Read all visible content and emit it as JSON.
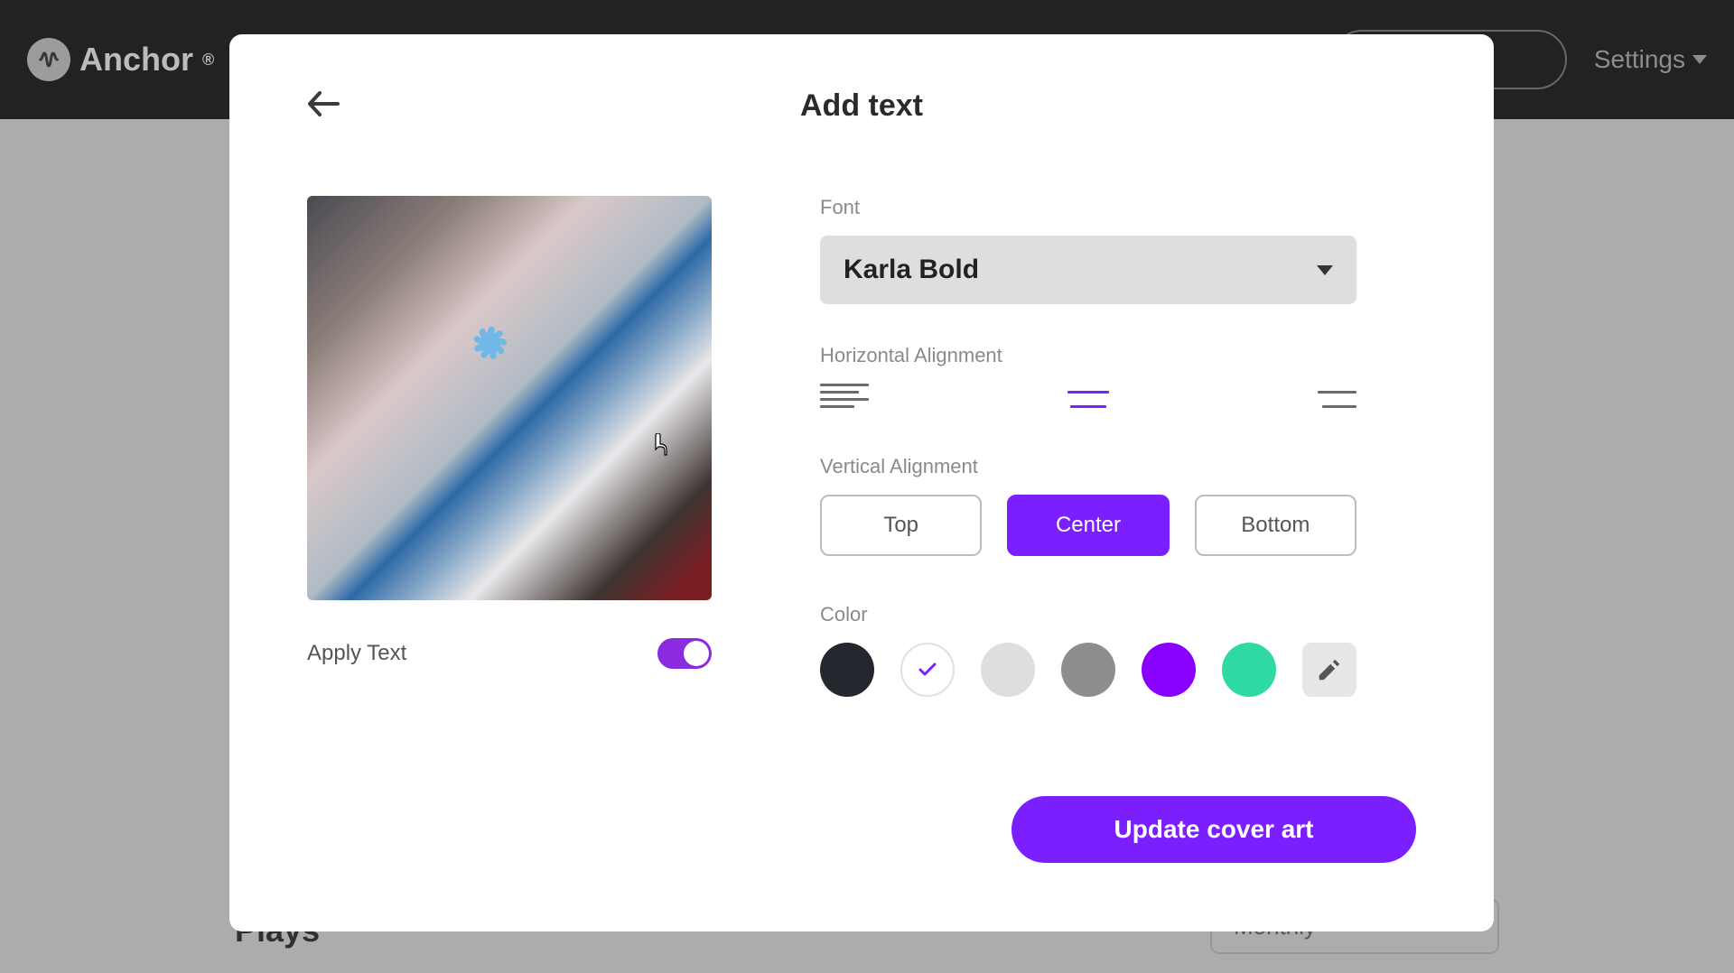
{
  "header": {
    "brand": "Anchor",
    "settings_label": "Settings"
  },
  "background": {
    "plays_label": "Plays",
    "period_label": "Monthly"
  },
  "modal": {
    "title": "Add text",
    "apply_text_label": "Apply Text",
    "apply_text_on": true,
    "font_label": "Font",
    "font_value": "Karla Bold",
    "halign_label": "Horizontal Alignment",
    "halign_selected": "center",
    "valign_label": "Vertical Alignment",
    "valign_options": {
      "top": "Top",
      "center": "Center",
      "bottom": "Bottom"
    },
    "valign_selected": "center",
    "color_label": "Color",
    "colors": {
      "dark": "#25272e",
      "white": "#ffffff",
      "lightgray": "#dedede",
      "gray": "#8d8d8d",
      "purple": "#8a00ff",
      "teal": "#2fd9a3"
    },
    "color_selected": "white",
    "update_button": "Update cover art"
  }
}
